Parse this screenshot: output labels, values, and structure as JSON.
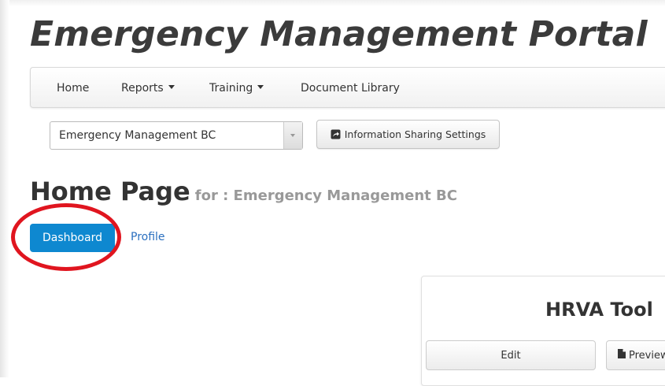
{
  "app": {
    "title": "Emergency Management Portal"
  },
  "navbar": {
    "items": [
      {
        "label": "Home",
        "has_dropdown": false
      },
      {
        "label": "Reports",
        "has_dropdown": true
      },
      {
        "label": "Training",
        "has_dropdown": true
      },
      {
        "label": "Document Library",
        "has_dropdown": false
      }
    ]
  },
  "organization_select": {
    "value": "Emergency Management BC"
  },
  "sharing_button": {
    "label": "Information Sharing Settings",
    "icon": "share-icon"
  },
  "page": {
    "title": "Home Page",
    "subtitle": "for : Emergency Management BC"
  },
  "tabs": {
    "dashboard_label": "Dashboard",
    "profile_label": "Profile"
  },
  "annotation": {
    "highlight_color": "#e0151f",
    "target": "dashboard-button"
  },
  "tool_card": {
    "title": "HRVA Tool",
    "edit_label": "Edit",
    "preview_label": "Preview",
    "preview_icon": "document-icon"
  },
  "colors": {
    "primary_button": "#0e88d0",
    "link": "#2a6fbf",
    "title_text": "#3b3b3b"
  }
}
